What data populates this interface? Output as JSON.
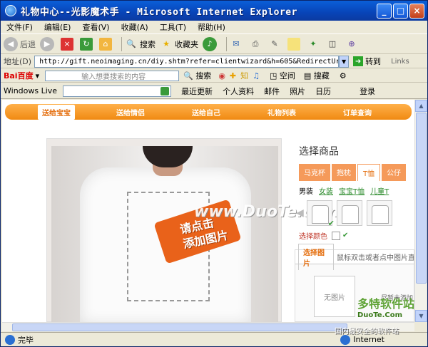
{
  "window": {
    "title": "礼物中心--光影魔术手 - Microsoft Internet Explorer"
  },
  "menu": [
    "文件(F)",
    "编辑(E)",
    "查看(V)",
    "收藏(A)",
    "工具(T)",
    "帮助(H)"
  ],
  "toolbar": {
    "back": "后退",
    "search": "搜索",
    "favorites": "收藏夹"
  },
  "address": {
    "label": "地址(D)",
    "url": "http://gift.neoimaging.cn/diy.shtm?refer=clientwizard&h=605&RedirectUrl=htt",
    "go": "转到",
    "links": "Links"
  },
  "baidu": {
    "logo": "Bai百度",
    "placeholder": "输入想要搜索的内容",
    "search": "搜索",
    "space": "空间",
    "bar_search": "搜藏"
  },
  "live": {
    "label": "Windows Live",
    "links": [
      "最近更新",
      "个人资料",
      "邮件",
      "照片",
      "日历"
    ],
    "login": "登录"
  },
  "nav": {
    "items": [
      "送给宝宝",
      "送给情侣",
      "送给自己",
      "礼物列表",
      "订单查询"
    ]
  },
  "canvas": {
    "arrow_text_1": "请点击",
    "arrow_text_2": "添加图片",
    "watermark": "www.DuoTe.com"
  },
  "shop": {
    "title": "选择商品",
    "tabs": [
      "马克杯",
      "抱枕",
      "T恤",
      "公仔"
    ],
    "subtabs": [
      "男装",
      "女装",
      "宝宝T恤",
      "儿童T"
    ],
    "color_label": "选择颜色"
  },
  "pictures": {
    "tab": "选择图片",
    "hint": "鼠标双击或者点中图片直接",
    "noimg": "无图片",
    "notadded": "尽暂未添加"
  },
  "status": {
    "text": "完毕",
    "zone": "Internet"
  },
  "logo": {
    "name": "多特软件站",
    "url": "DuoTe.Com",
    "slogan": "国内最安全的软件站"
  }
}
